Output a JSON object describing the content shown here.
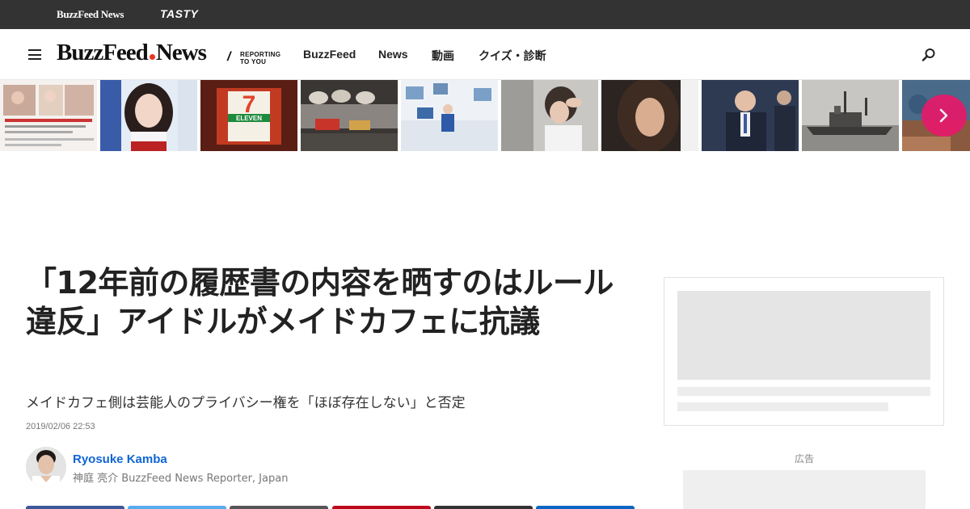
{
  "network_bar": {
    "buzzfeed_news_label": "BuzzFeed News",
    "tasty_label": "TASTY"
  },
  "header": {
    "logo_part1": "BuzzFeed",
    "logo_part2": "News",
    "tagline_line1": "REPORTING",
    "tagline_line2": "TO YOU",
    "nav": [
      "BuzzFeed",
      "News",
      "動画",
      "クイズ・診断"
    ]
  },
  "colors": {
    "network_bar": "#333333",
    "link_blue": "#0f65d6",
    "carousel_next": "#e6196a",
    "logo_dot": "#ee3322"
  },
  "carousel": {
    "thumbnail_count": 10,
    "icons": [
      "menu-icon",
      "search-icon",
      "chevron-right-icon"
    ]
  },
  "article": {
    "headline": "「12年前の履歴書の内容を晒すのはルール違反」アイドルがメイドカフェに抗議",
    "dek": "メイドカフェ側は芸能人のプライバシー権を「ほぼ存在しない」と否定",
    "timestamp": "2019/02/06 22:53",
    "author": {
      "name": "Ryosuke Kamba",
      "role": "神庭 亮介 BuzzFeed News Reporter, Japan"
    }
  },
  "sidebar": {
    "ad_label": "広告"
  },
  "share_colors": [
    "#3b5998",
    "#55acee",
    "#555555",
    "#bd081c",
    "#333333",
    "#0a66c2"
  ]
}
